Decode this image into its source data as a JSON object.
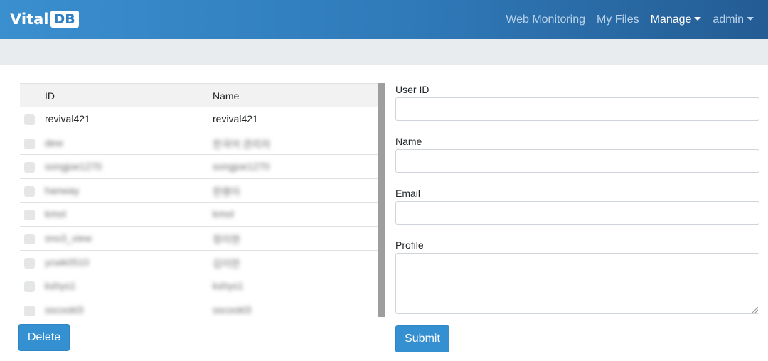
{
  "brand": {
    "text": "Vital",
    "box": "DB"
  },
  "nav": {
    "web_monitoring": "Web Monitoring",
    "my_files": "My Files",
    "manage": "Manage",
    "admin": "admin"
  },
  "table": {
    "columns": [
      "ID",
      "Name"
    ],
    "rows": [
      {
        "id": "revival421",
        "name": "revival421"
      },
      {
        "id": "dew",
        "name": "한국어 관리자"
      },
      {
        "id": "songjoe1270",
        "name": "songjoe1270"
      },
      {
        "id": "hanway",
        "name": "한명이"
      },
      {
        "id": "kmol",
        "name": "kmol"
      },
      {
        "id": "sno3_view",
        "name": "정이현"
      },
      {
        "id": "ycwk0510",
        "name": "김이란"
      },
      {
        "id": "kshys1",
        "name": "kshys1"
      },
      {
        "id": "sscookl3",
        "name": "sscookl3"
      }
    ]
  },
  "buttons": {
    "delete": "Delete",
    "submit": "Submit"
  },
  "form": {
    "user_id_label": "User ID",
    "name_label": "Name",
    "email_label": "Email",
    "profile_label": "Profile",
    "user_id_value": "",
    "name_value": "",
    "email_value": "",
    "profile_value": ""
  },
  "colors": {
    "navbar_start": "#3a8fcf",
    "navbar_end": "#245c94",
    "button": "#3490d0",
    "subbar": "#e9ecef"
  }
}
